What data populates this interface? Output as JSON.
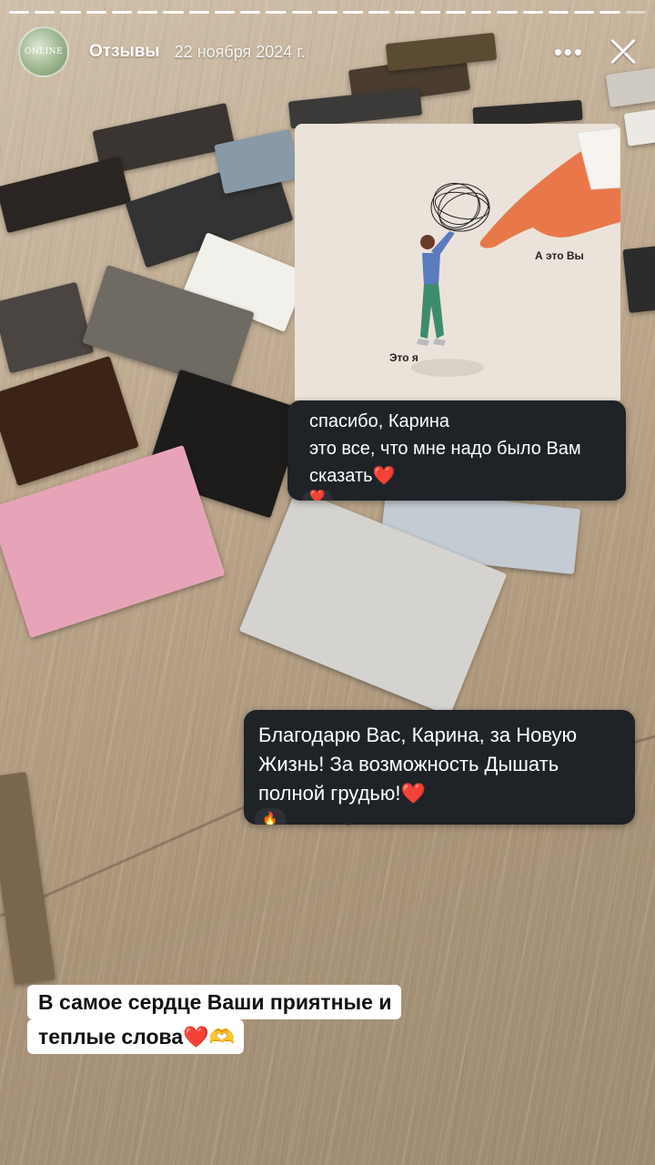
{
  "story": {
    "progress_segments": 25,
    "account_name": "Отзывы",
    "date": "22 ноября 2024 г.",
    "avatar_text": "ONLINE",
    "more_label": "•••"
  },
  "screenshot_1": {
    "label_self": "Это я",
    "label_other": "А это Вы",
    "message": "спасибо, Карина\nэто все, что мне надо было Вам сказать❤️",
    "reaction": "❤️"
  },
  "screenshot_2": {
    "message": "Благодарю Вас, Карина, за Новую Жизнь! За возможность Дышать полной грудью!❤️",
    "reaction": "🔥"
  },
  "caption": {
    "line1": "В самое сердце Ваши приятные и",
    "line2": "теплые слова❤️🫶"
  },
  "colors": {
    "bubble_bg": "#1f2328",
    "caption_bg": "#ffffff",
    "illustration_bg": "#ebe3da"
  }
}
